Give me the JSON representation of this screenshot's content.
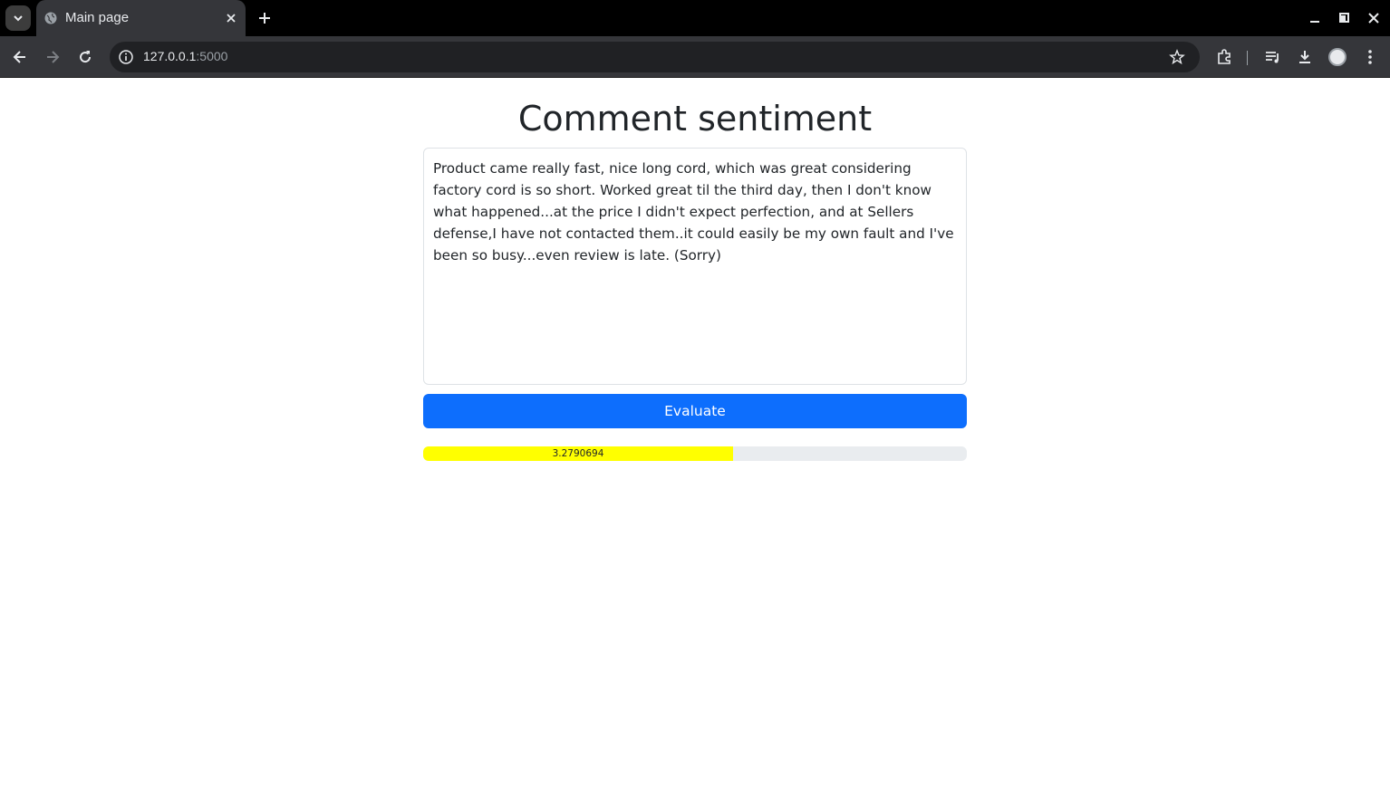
{
  "browser": {
    "tab_title": "Main page",
    "url_host": "127.0.0.1",
    "url_port": ":5000"
  },
  "page": {
    "title": "Comment sentiment",
    "comment_text": "Product came really fast, nice long cord, which was great considering factory cord is so short. Worked great til the third day, then I don't know what happened...at the price I didn't expect perfection, and at Sellers defense,I have not contacted them..it could easily be my own fault and I've been so busy...even review is late. (Sorry)",
    "evaluate_label": "Evaluate",
    "score_label": "3.2790694",
    "score_fill_fraction": 0.57,
    "score_bar_color": "#ffff00",
    "button_color": "#0d6efd"
  }
}
